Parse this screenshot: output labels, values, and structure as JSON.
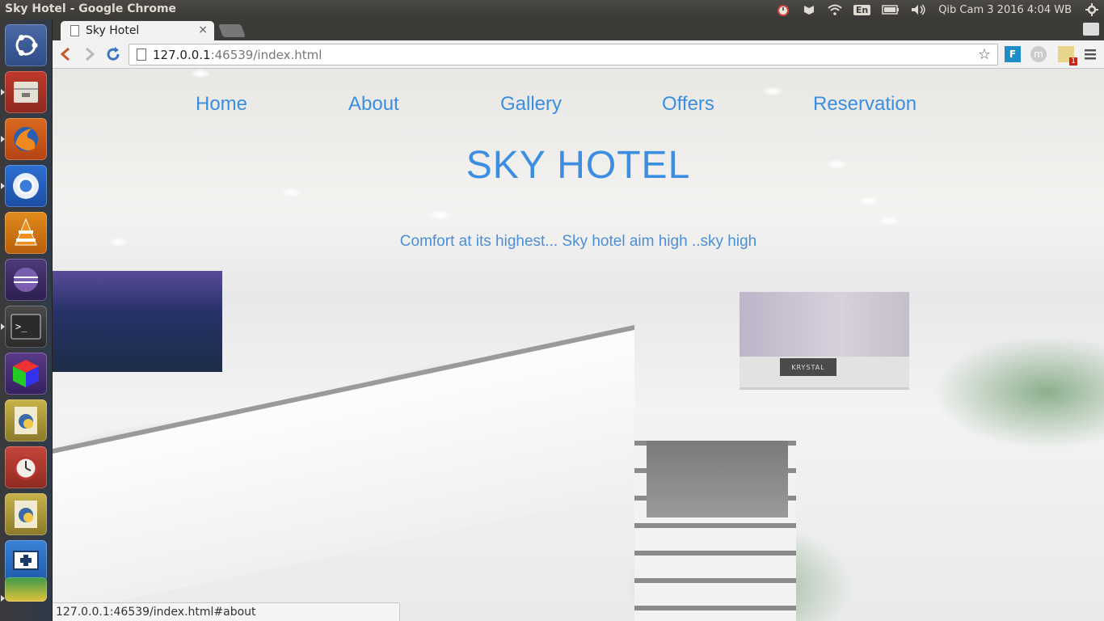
{
  "panel": {
    "window_title": "Sky Hotel - Google Chrome",
    "language": "En",
    "clock": "Qib Cam  3 2016  4:04 WB"
  },
  "launcher": {
    "items": [
      "ubuntu-dash",
      "files",
      "firefox",
      "chromium",
      "vlc",
      "eclipse",
      "terminal",
      "cube-app",
      "python-script",
      "alarm-clock",
      "python-script-2",
      "screenshot-tool",
      "chrome"
    ]
  },
  "browser": {
    "tab_title": "Sky Hotel",
    "tab_close": "×",
    "url_host": "127.0.0.1",
    "url_rest": ":46539/index.html",
    "status_url": "127.0.0.1:46539/index.html#about",
    "ext_badge": "1"
  },
  "site": {
    "nav": [
      "Home",
      "About",
      "Gallery",
      "Offers",
      "Reservation"
    ],
    "title": "SKY HOTEL",
    "tagline": "Comfort at its highest... Sky hotel aim high ..sky high",
    "sign_text": "KRYSTAL",
    "accent_color": "#3b8ee0"
  }
}
